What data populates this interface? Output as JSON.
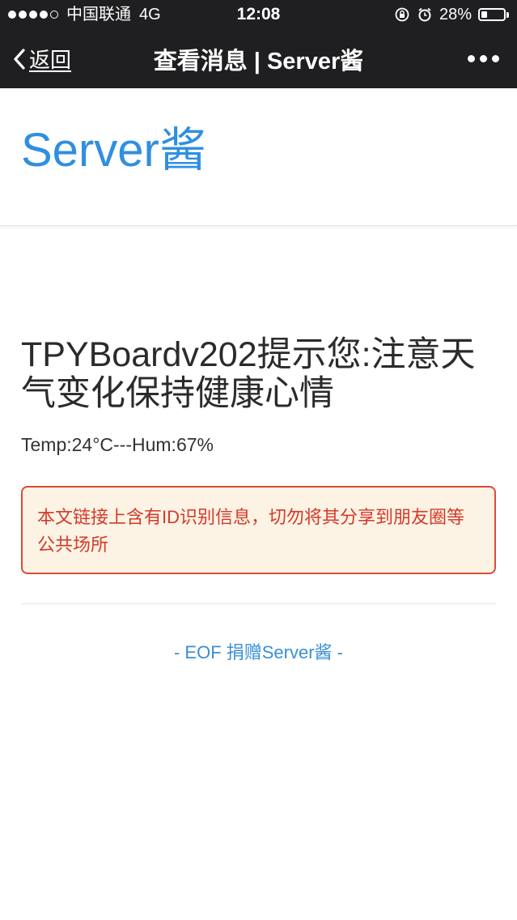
{
  "status_bar": {
    "carrier": "中国联通",
    "network": "4G",
    "time": "12:08",
    "battery": "28%",
    "battery_level": 0.28,
    "icons": [
      "signal-dots",
      "rotation-lock-icon",
      "alarm-icon",
      "battery-icon"
    ]
  },
  "nav": {
    "back_label": "返回",
    "title": "查看消息 | Server酱",
    "more_icon": "more-dots-icon"
  },
  "header": {
    "brand": "Server酱"
  },
  "message": {
    "title": "TPYBoardv202提示您:注意天气变化保持健康心情",
    "body": "Temp:24°C---Hum:67%"
  },
  "warning": {
    "text": "本文链接上含有ID识别信息，切勿将其分享到朋友圈等公共场所"
  },
  "footer": {
    "prefix": "- EOF ",
    "donate": "捐赠Server酱",
    "suffix": " -"
  },
  "colors": {
    "topbar": "#1f1f21",
    "brand": "#2f8fe0",
    "warning_border": "#dd4a37",
    "warning_bg": "#fdf3e4",
    "warning_text": "#d33a2a",
    "footer_link": "#3a8fd4"
  }
}
